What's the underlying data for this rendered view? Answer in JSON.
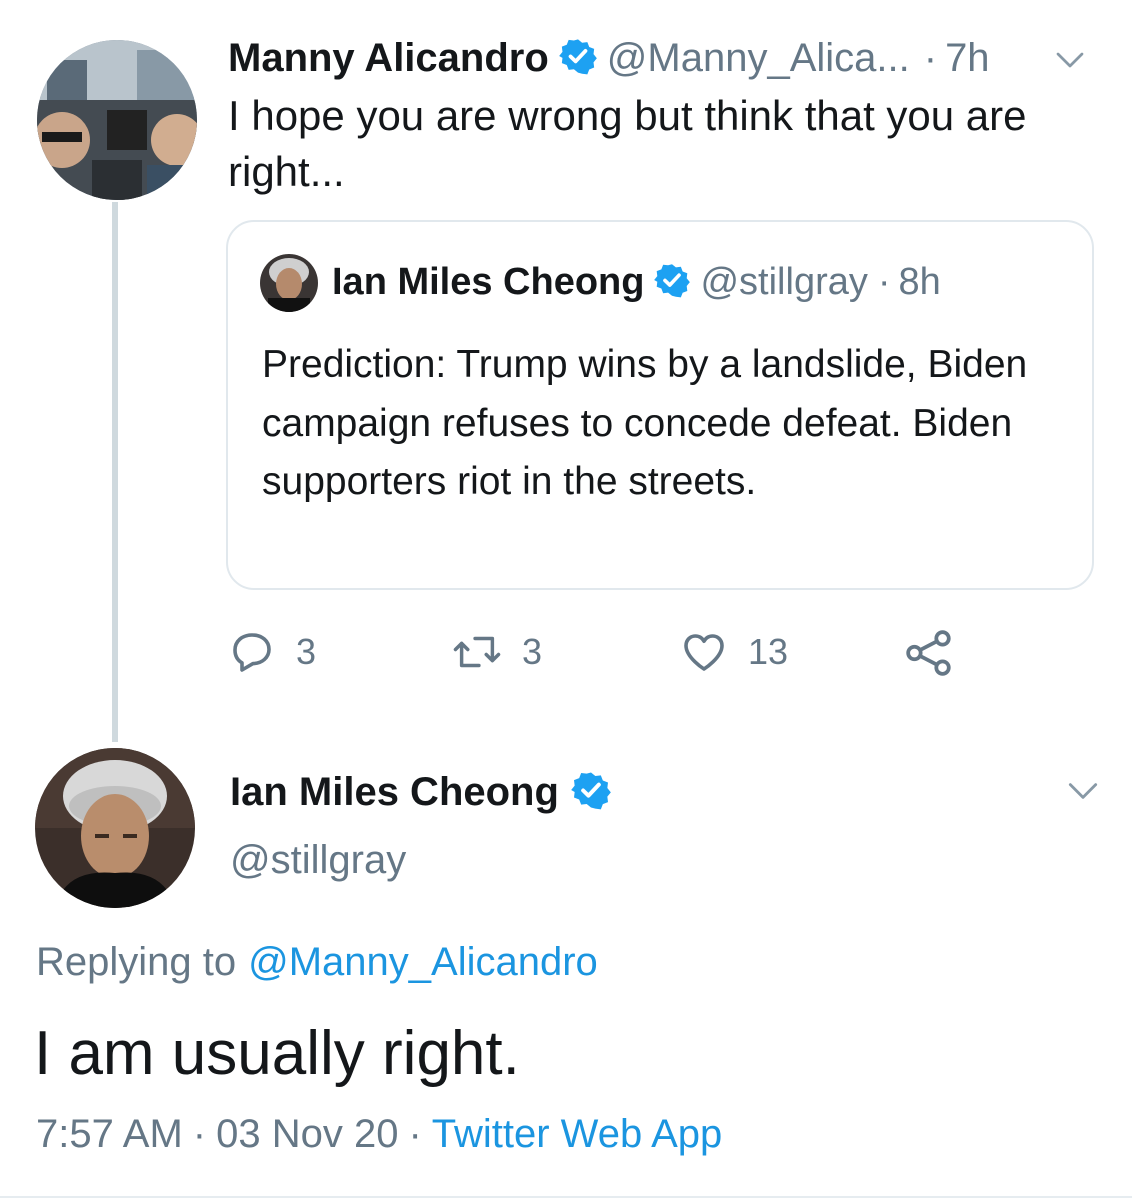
{
  "tweet1": {
    "name": "Manny Alicandro",
    "handle": "@Manny_Alica...",
    "time": "7h",
    "separator": "·",
    "text": "I hope you are wrong but think that you are right..."
  },
  "quote": {
    "name": "Ian Miles Cheong",
    "handle": "@stillgray",
    "separator": "·",
    "time": "8h",
    "text": "Prediction: Trump wins by a landslide, Biden campaign refuses to concede defeat. Biden supporters riot in the streets."
  },
  "actions": {
    "replies": "3",
    "retweets": "3",
    "likes": "13"
  },
  "tweet2": {
    "name": "Ian Miles Cheong",
    "handle": "@stillgray",
    "replying_prefix": "Replying to",
    "replying_handle": "@Manny_Alicandro",
    "text": "I am usually right.",
    "time": "7:57 AM",
    "date": "03 Nov 20",
    "separator": "·",
    "source": "Twitter Web App"
  },
  "colors": {
    "link": "#1b95e0",
    "verified": "#1da1f2",
    "muted": "#657786"
  }
}
